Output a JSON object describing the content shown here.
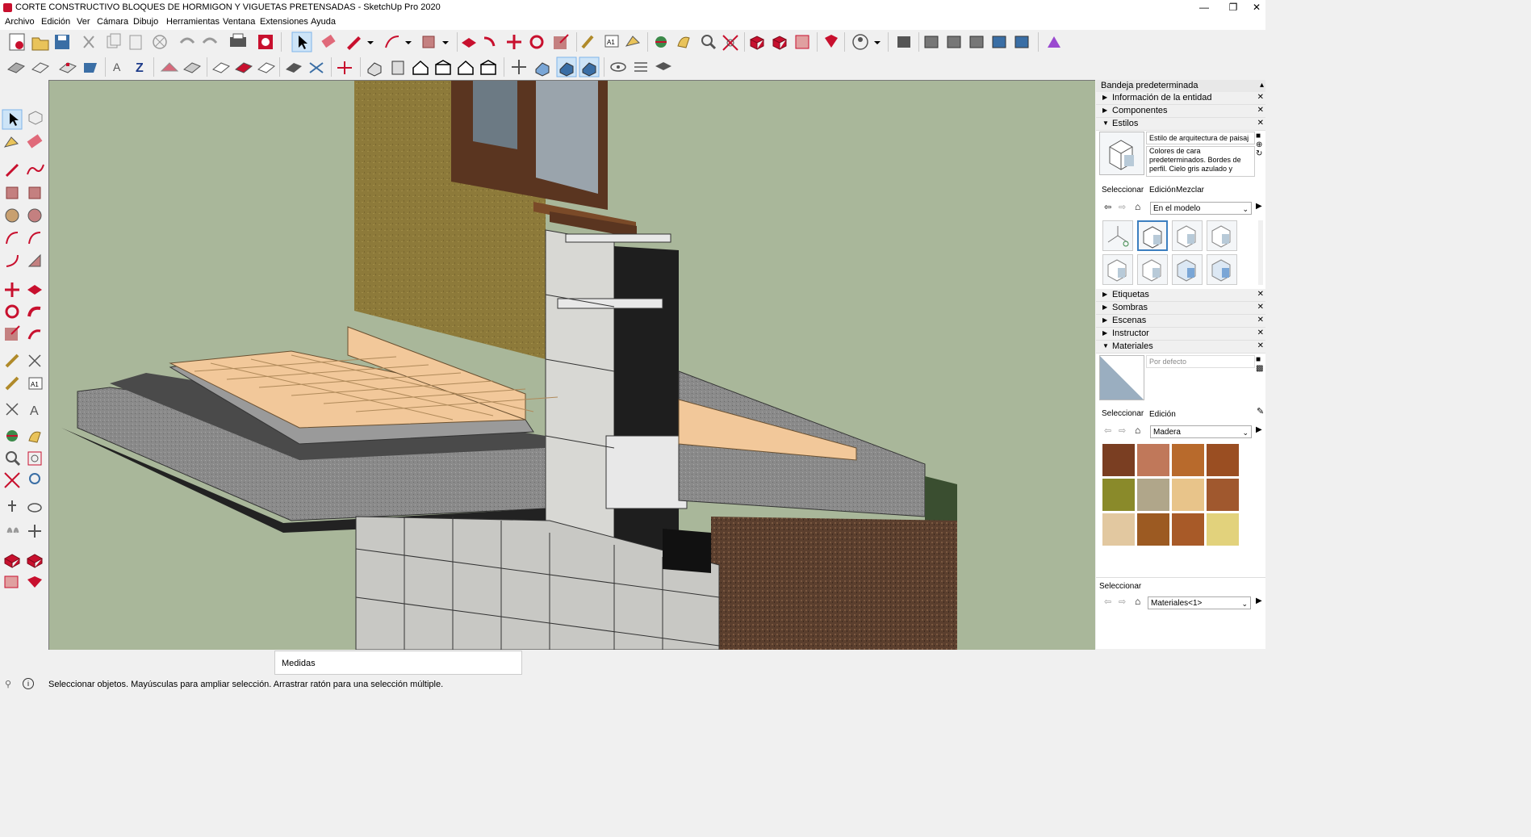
{
  "window": {
    "title": "CORTE CONSTRUCTIVO BLOQUES DE HORMIGON Y VIGUETAS PRETENSADAS - SketchUp Pro 2020",
    "minimize_icon": "minimize-icon",
    "restore_icon": "restore-icon",
    "close_icon": "close-icon"
  },
  "menu": {
    "items": [
      "Archivo",
      "Edición",
      "Ver",
      "Cámara",
      "Dibujo",
      "Herramientas",
      "Ventana",
      "Extensiones",
      "Ayuda"
    ]
  },
  "tray": {
    "title": "Bandeja predeterminada",
    "sections": {
      "entity_info": "Información de la entidad",
      "components": "Componentes",
      "styles": "Estilos",
      "tags": "Etiquetas",
      "shadows": "Sombras",
      "scenes": "Escenas",
      "instructor": "Instructor",
      "materials": "Materiales"
    },
    "styles": {
      "style_name": "Estilo de arquitectura de paisaj",
      "description_lines": [
        "Colores de cara",
        "predeterminados. Bordes de",
        "perfil. Cielo gris azulado y"
      ],
      "tabs": [
        "Seleccionar",
        "Edición",
        "Mezclar"
      ],
      "collection": "En el modelo"
    },
    "materials": {
      "current": "Por defecto",
      "tabs": [
        "Seleccionar",
        "Edición"
      ],
      "collection": "Madera",
      "swatch_colors": [
        "#7a3e22",
        "#c0785a",
        "#b86a2c",
        "#9a4e22",
        "#8a8a2a",
        "#b0a68a",
        "#e8c48a",
        "#a0582e",
        "#e2c8a0",
        "#9c5a22",
        "#a85a28",
        "#e2d27c"
      ],
      "bottom_label": "Seleccionar",
      "bottom_collection": "Materiales<1>"
    }
  },
  "measurements": {
    "label": "Medidas"
  },
  "status": {
    "text": "Seleccionar objetos. Mayúsculas para ampliar selección. Arrastrar ratón para una selección múltiple."
  }
}
